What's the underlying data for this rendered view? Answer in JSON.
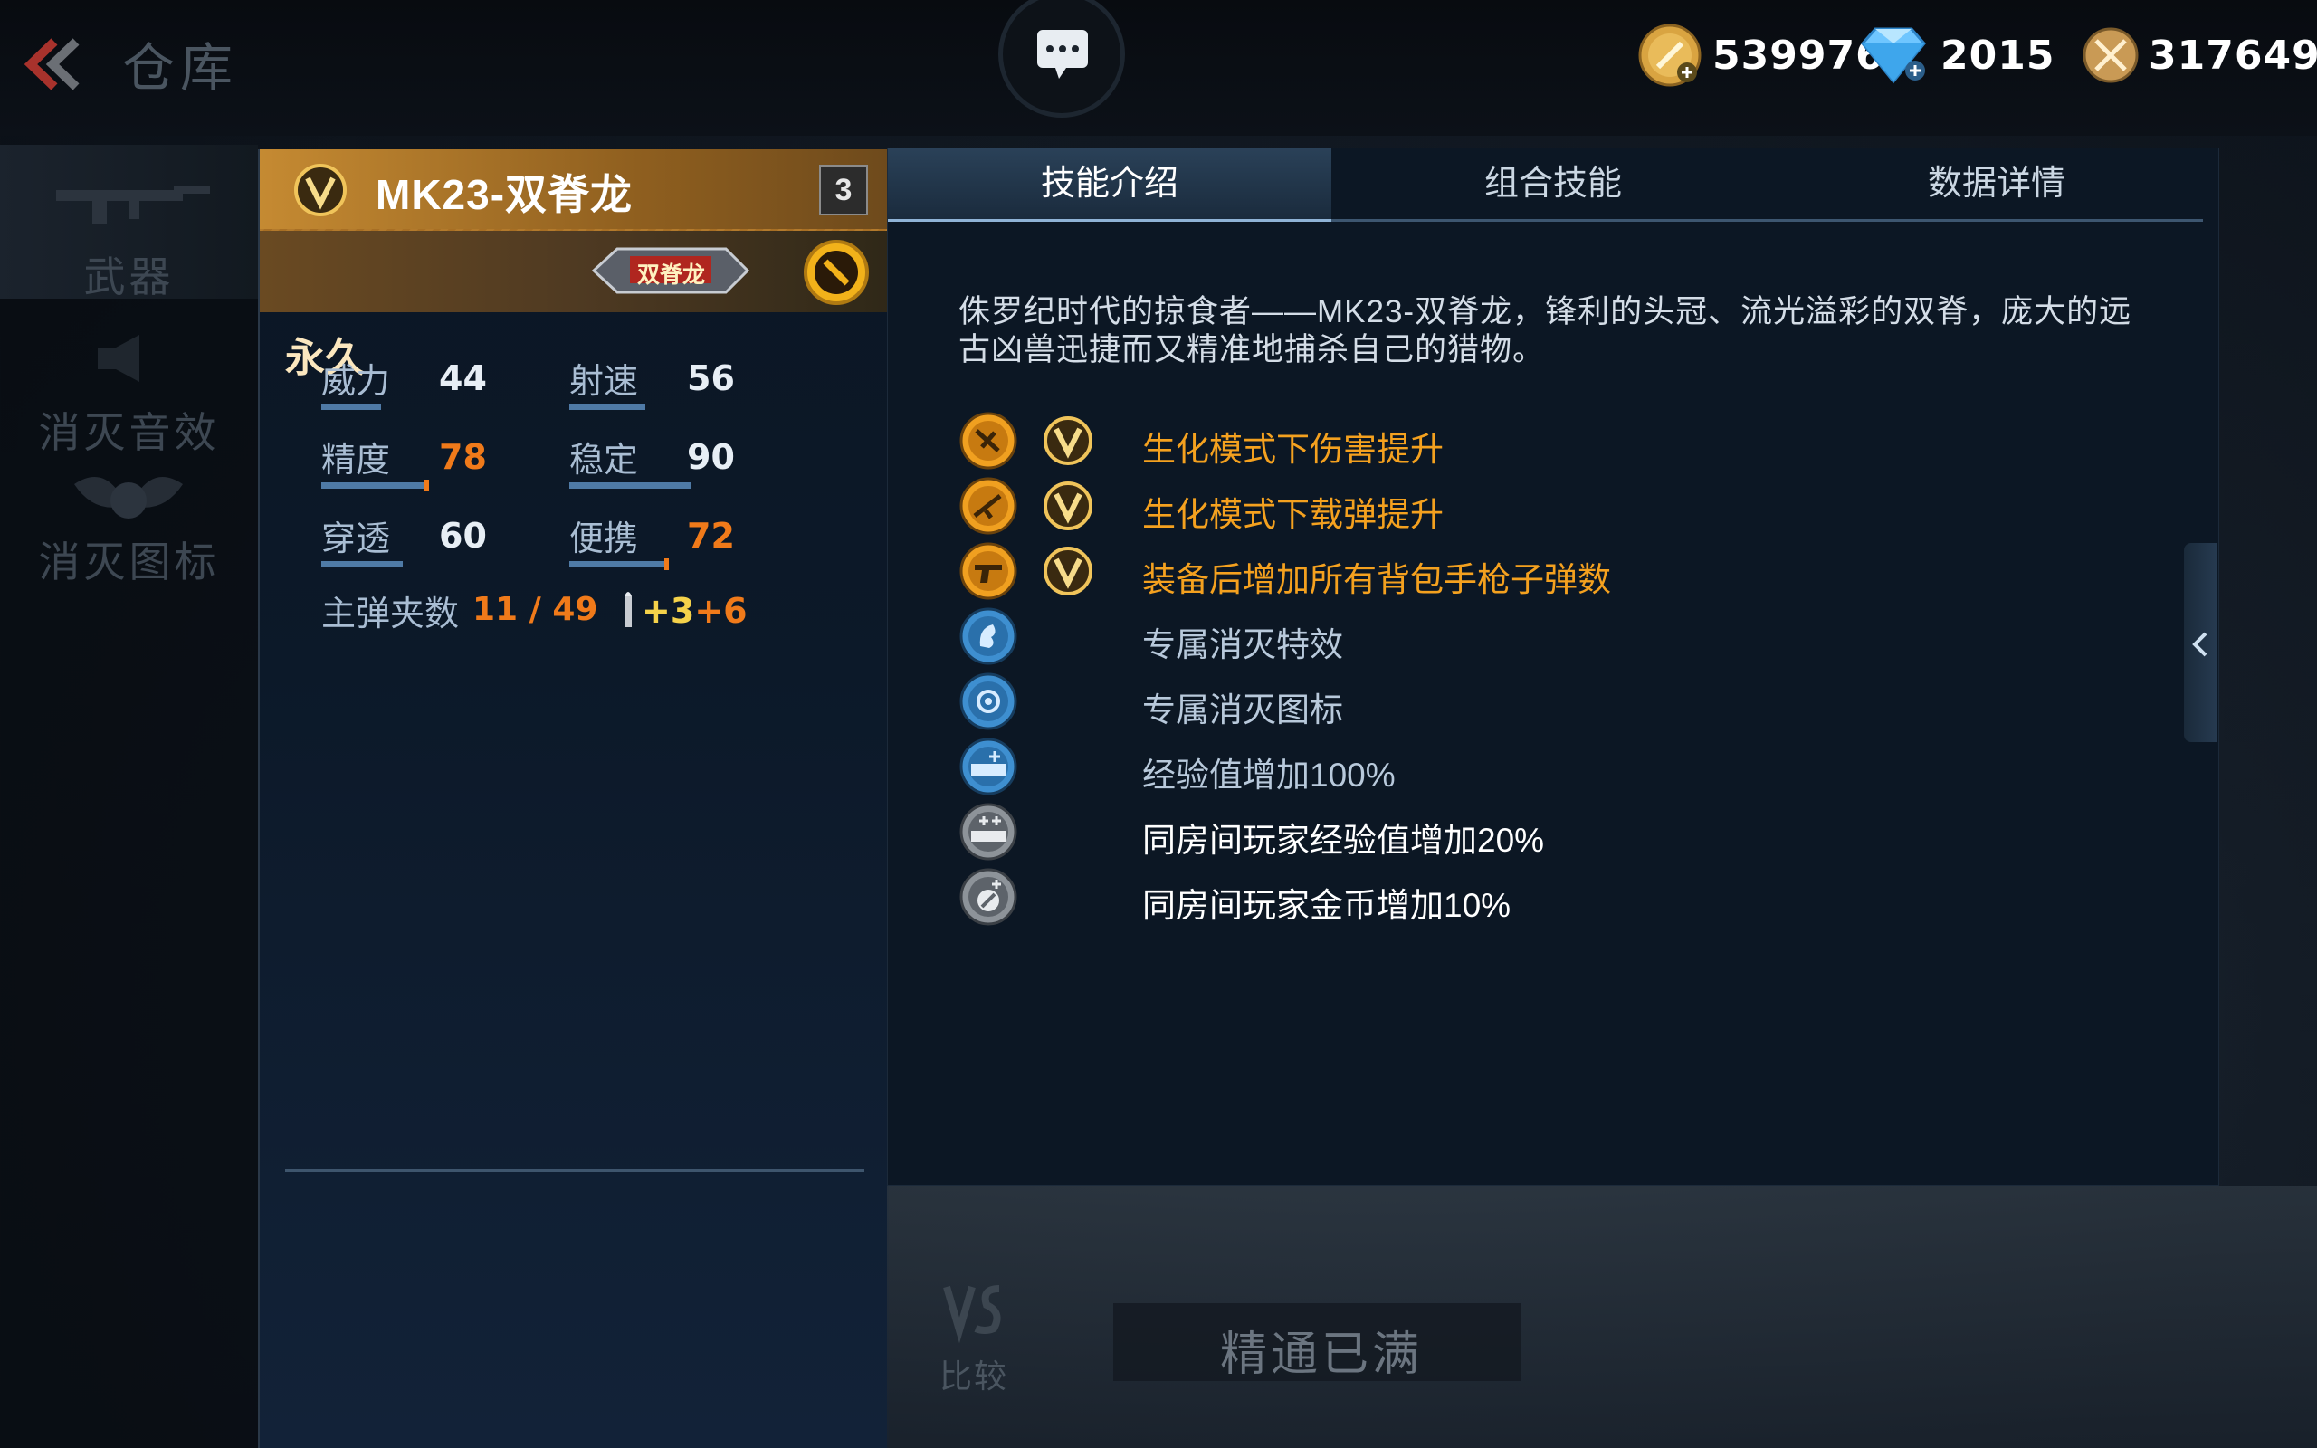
{
  "header": {
    "title": "仓库",
    "currencies": [
      {
        "icon": "gold-coin-icon",
        "value": "539976"
      },
      {
        "icon": "diamond-icon",
        "value": "2015"
      },
      {
        "icon": "honor-medal-icon",
        "value": "317649"
      }
    ]
  },
  "sidebar": {
    "items": [
      {
        "label": "武器",
        "icon": "rifle-icon"
      },
      {
        "label": "消灭音效",
        "icon": "speaker-icon"
      },
      {
        "label": "消灭图标",
        "icon": "skull-wings-icon"
      }
    ]
  },
  "weapon": {
    "name": "MK23-双脊龙",
    "level": "3",
    "duration": "永久",
    "tag": "双脊龙",
    "stats": [
      {
        "name": "威力",
        "value": "44",
        "fill": 0.44
      },
      {
        "name": "射速",
        "value": "56",
        "fill": 0.56
      },
      {
        "name": "精度",
        "value": "78",
        "fill": 0.78,
        "highlight": "#f07a1a"
      },
      {
        "name": "稳定",
        "value": "90",
        "fill": 0.9
      },
      {
        "name": "穿透",
        "value": "60",
        "fill": 0.6
      },
      {
        "name": "便携",
        "value": "72",
        "fill": 0.72,
        "highlight": "#f07a1a"
      }
    ],
    "magazine_label": "主弹夹数",
    "magazine_value": "11 / 49",
    "ammo_bonus_a": "+3",
    "ammo_bonus_b": "+6"
  },
  "tabs": [
    {
      "label": "技能介绍",
      "active": true
    },
    {
      "label": "组合技能",
      "active": false
    },
    {
      "label": "数据详情",
      "active": false
    }
  ],
  "description": "侏罗纪时代的掠食者——MK23-双脊龙，锋利的头冠、流光溢彩的双脊，庞大的远古凶兽迅捷而又精准地捕杀自己的猎物。",
  "skills": [
    {
      "text": "生化模式下伤害提升",
      "icon": "zombie-damage-icon",
      "vip": true,
      "color": "gold"
    },
    {
      "text": "生化模式下载弹提升",
      "icon": "zombie-ammo-icon",
      "vip": true,
      "color": "gold"
    },
    {
      "text": "装备后增加所有背包手枪子弹数",
      "icon": "pistol-icon",
      "vip": true,
      "color": "gold"
    },
    {
      "text": "专属消灭特效",
      "icon": "kill-effect-icon",
      "vip": false,
      "color": "blue"
    },
    {
      "text": "专属消灭图标",
      "icon": "kill-icon-icon",
      "vip": false,
      "color": "blue"
    },
    {
      "text": "经验值增加100%",
      "icon": "exp-icon",
      "vip": false,
      "color": "blue"
    },
    {
      "text": "同房间玩家经验值增加20%",
      "icon": "room-exp-icon",
      "vip": false,
      "color": "white"
    },
    {
      "text": "同房间玩家金币增加10%",
      "icon": "room-coin-icon",
      "vip": false,
      "color": "white"
    }
  ],
  "bottom": {
    "compare_label": "比较",
    "mastery_label": "精通已满"
  },
  "colors": {
    "gold": "#f4a11f",
    "accent_orange": "#f07a1a",
    "bar_blue": "#4f7aa6"
  }
}
